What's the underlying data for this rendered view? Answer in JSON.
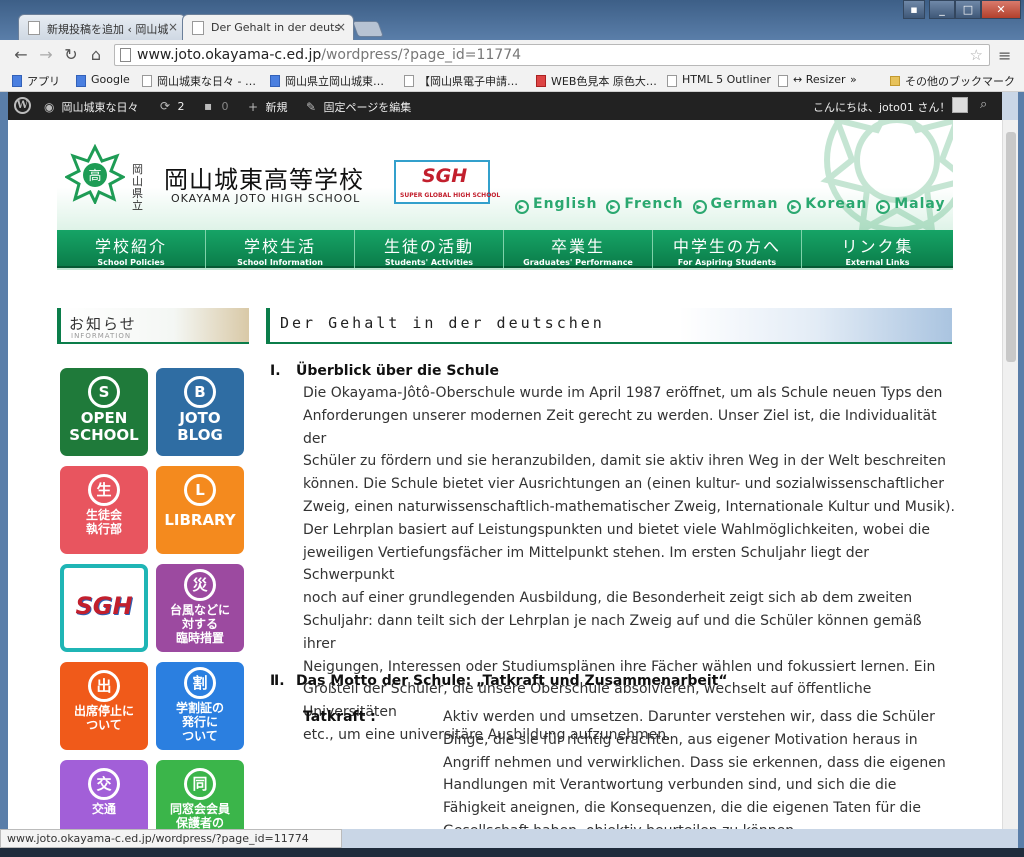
{
  "browser": {
    "tabs": [
      {
        "title": "新規投稿を追加 ‹ 岡山城"
      },
      {
        "title": "Der Gehalt in der deuts"
      }
    ],
    "url_host": "www.joto.okayama-c.ed.jp",
    "url_path": "/wordpress/?page_id=11774",
    "bookmarks": [
      "アプリ",
      "Google",
      "岡山城東な日々 - …",
      "岡山県立岡山城東…",
      "【岡山県電子申請…",
      "WEB色見本 原色大…",
      "HTML 5 Outliner",
      "↔ Resizer",
      "»",
      "その他のブックマーク"
    ],
    "status_url": "www.joto.okayama-c.ed.jp/wordpress/?page_id=11774"
  },
  "adminbar": {
    "site_name": "岡山城東な日々",
    "updates_count": "2",
    "comments_count": "0",
    "new_label": "新規",
    "edit_label": "固定ページを編集",
    "greeting": "こんにちは、joto01 さん！"
  },
  "header": {
    "pref_1": "岡山",
    "pref_2": "県立",
    "school_name": "岡山城東高等学校",
    "school_name_en": "OKAYAMA JOTO HIGH SCHOOL",
    "sgh_logo": "SGH",
    "sgh_caption": "SUPER GLOBAL HIGH SCHOOL",
    "languages": [
      "English",
      "French",
      "German",
      "Korean",
      "Malay"
    ],
    "nav": [
      {
        "jp": "学校紹介",
        "en": "School Policies"
      },
      {
        "jp": "学校生活",
        "en": "School Information"
      },
      {
        "jp": "生徒の活動",
        "en": "Students' Activities"
      },
      {
        "jp": "卒業生",
        "en": "Graduates' Performance"
      },
      {
        "jp": "中学生の方へ",
        "en": "For Aspiring Students"
      },
      {
        "jp": "リンク集",
        "en": "External Links"
      }
    ]
  },
  "sidebar": {
    "news_title": "お知らせ",
    "news_sub": "INFORMATION",
    "tiles": [
      {
        "icon": "S",
        "label1": "OPEN",
        "label2": "SCHOOL",
        "color": "#1f7a3a"
      },
      {
        "icon": "B",
        "label1": "JOTO",
        "label2": "BLOG",
        "color": "#2f6da3"
      },
      {
        "icon": "生",
        "label1": "生徒会",
        "label2": "執行部",
        "color": "#e8555f"
      },
      {
        "icon": "L",
        "label1": "LIBRARY",
        "label2": "",
        "color": "#f48a1e"
      },
      {
        "icon": "SGH",
        "label1": "",
        "label2": "",
        "color": "#ffffff"
      },
      {
        "icon": "災",
        "label1": "台風などに",
        "label2": "対する",
        "label3": "臨時措置",
        "color": "#9c4aa0"
      },
      {
        "icon": "出",
        "label1": "出席停止に",
        "label2": "ついて",
        "color": "#f05a1a"
      },
      {
        "icon": "割",
        "label1": "学割証の",
        "label2": "発行に",
        "label3": "ついて",
        "color": "#2b7fe0"
      },
      {
        "icon": "交",
        "label1": "交通",
        "label2": "",
        "color": "#a25fd8"
      },
      {
        "icon": "同",
        "label1": "同窓会会員",
        "label2": "保護者の",
        "color": "#3bb54a"
      }
    ]
  },
  "content": {
    "heading": "Der Gehalt in der deutschen",
    "s1_num": "Ⅰ.",
    "s1_title": "Überblick über die Schule",
    "s1_lines": [
      "Die Okayama-Jôtô-Oberschule wurde im April 1987 eröffnet, um als Schule neuen Typs den",
      "Anforderungen unserer modernen Zeit gerecht zu werden. Unser Ziel ist, die Individualität der",
      "Schüler zu fördern und sie heranzubilden, damit sie aktiv ihren Weg in der Welt beschreiten",
      "können. Die Schule bietet vier Ausrichtungen an (einen kultur- und sozialwissenschaftlicher",
      "Zweig, einen naturwissenschaftlich-mathematischer Zweig, Internationale Kultur und Musik).",
      "Der Lehrplan basiert auf Leistungspunkten und bietet viele Wahlmöglichkeiten, wobei die",
      "jeweiligen Vertiefungsfächer im Mittelpunkt stehen. Im ersten Schuljahr liegt der Schwerpunkt",
      "noch auf einer grundlegenden Ausbildung, die Besonderheit zeigt sich ab dem zweiten",
      "Schuljahr: dann teilt sich der Lehrplan je nach Zweig auf und die Schüler können gemäß ihrer",
      "Neigungen, Interessen oder Studiumsplänen ihre Fächer wählen und fokussiert lernen. Ein",
      "Großteil der Schüler, die unsere Oberschule absolvieren, wechselt auf öffentliche Universitäten",
      "etc., um eine universitäre Ausbildung aufzunehmen."
    ],
    "s2_num": "Ⅱ.",
    "s2_title": "Das Motto der Schule: „Tatkraft und Zusammenarbeit“",
    "def_term": "Tatkraft :",
    "def_lines": [
      "Aktiv werden und umsetzen. Darunter verstehen wir, dass die Schüler",
      "Dinge, die sie für richtig erachten, aus eigener Motivation heraus in",
      "Angriff nehmen und verwirklichen. Dass sie erkennen, dass die eigenen",
      "Handlungen mit Verantwortung verbunden sind, und sich die die",
      "Fähigkeit aneignen, die Konsequenzen, die die eigenen Taten für die",
      "Gesellschaft haben, objektiv beurteilen zu können."
    ]
  }
}
